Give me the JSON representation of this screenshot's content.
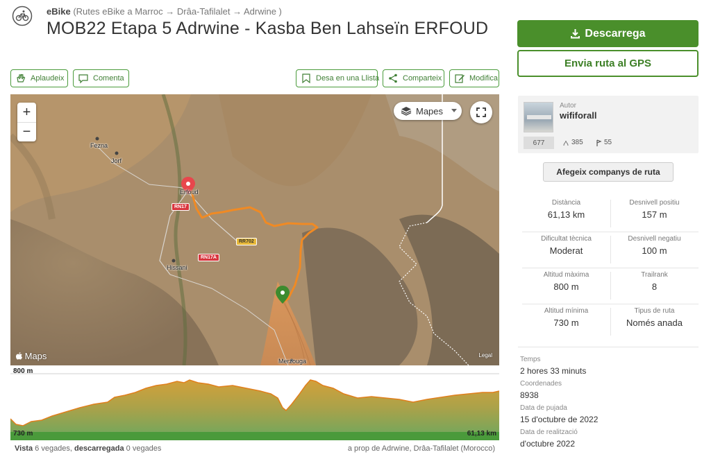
{
  "header": {
    "sport": "eBike",
    "breadcrumb": "(Rutes eBike a Marroc → Drâa-Tafilalet → Adrwine )",
    "title": "MOB22 Etapa 5 Adrwine - Kasba Ben Lahseïn ERFOUD"
  },
  "actions": {
    "applaud": "Aplaudeix",
    "comment": "Comenta",
    "save_list": "Desa en una Llista",
    "share": "Comparteix",
    "edit": "Modifica"
  },
  "map": {
    "zoom_in": "+",
    "zoom_out": "−",
    "layer_button": "Mapes",
    "attribution": "Maps",
    "legal": "Legal",
    "places": {
      "fezna": "Fezna",
      "jorf": "Jorf",
      "erfoud": "Erfoud",
      "hissani": "Hissani",
      "merzouga": "Merzouga"
    },
    "roads": {
      "rn17": "RN17",
      "rr702": "RR702",
      "rn17a": "RN17A"
    },
    "colors": {
      "route": "#f08a24",
      "start_pin": "#e8464c",
      "end_pin": "#3d8b2f"
    }
  },
  "profile": {
    "max_elevation": "800 m",
    "min_elevation": "730 m",
    "distance": "61,13 km"
  },
  "footer": {
    "views_label": "Vista",
    "views_text": "6 vegades,",
    "downloads_label": "descarregada",
    "downloads_text": "0 vegades",
    "nearby": "a prop de Adrwine, Drâa-Tafilalet (Morocco)"
  },
  "sidebar": {
    "download_button": "Descarrega",
    "gps_button": "Envia ruta al GPS",
    "author": {
      "label": "Autor",
      "name": "wififorall",
      "trails": "677",
      "followers": "385",
      "following": "55"
    },
    "companions_button": "Afegeix companys de ruta",
    "stats": [
      {
        "label": "Distància",
        "value": "61,13 km"
      },
      {
        "label": "Desnivell positiu",
        "value": "157 m"
      },
      {
        "label": "Dificultat tècnica",
        "value": "Moderat"
      },
      {
        "label": "Desnivell negatiu",
        "value": "100 m"
      },
      {
        "label": "Altitud màxima",
        "value": "800 m"
      },
      {
        "label": "Trailrank",
        "value": "8"
      },
      {
        "label": "Altitud mínima",
        "value": "730 m"
      },
      {
        "label": "Tipus de ruta",
        "value": "Només anada"
      }
    ],
    "details": [
      {
        "label": "Temps",
        "value": "2 hores 33 minuts"
      },
      {
        "label": "Coordenades",
        "value": "8938"
      },
      {
        "label": "Data de pujada",
        "value": "15 d'octubre de 2022"
      },
      {
        "label": "Data de realització",
        "value": "d'octubre 2022"
      }
    ]
  }
}
